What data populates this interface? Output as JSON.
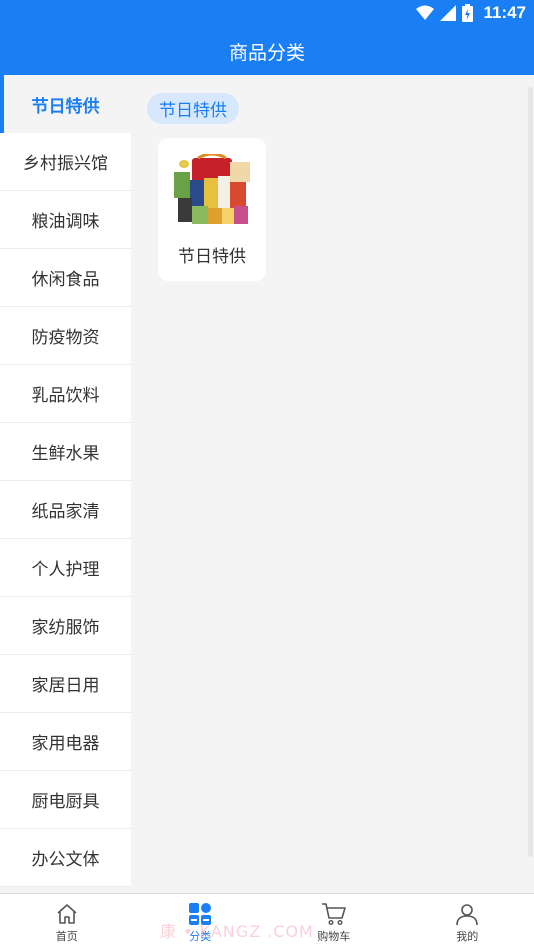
{
  "status_bar": {
    "time": "11:47"
  },
  "header": {
    "title": "商品分类"
  },
  "sidebar": {
    "items": [
      {
        "label": "节日特供",
        "active": true
      },
      {
        "label": "乡村振兴馆"
      },
      {
        "label": "粮油调味"
      },
      {
        "label": "休闲食品"
      },
      {
        "label": "防疫物资"
      },
      {
        "label": "乳品饮料"
      },
      {
        "label": "生鲜水果"
      },
      {
        "label": "纸品家清"
      },
      {
        "label": "个人护理"
      },
      {
        "label": "家纺服饰"
      },
      {
        "label": "家居日用"
      },
      {
        "label": "家用电器"
      },
      {
        "label": "厨电厨具"
      },
      {
        "label": "办公文体"
      }
    ]
  },
  "content": {
    "category_tag": "节日特供",
    "products": [
      {
        "name": "节日特供",
        "image": "gift-box-assortment"
      }
    ]
  },
  "tabbar": {
    "tabs": [
      {
        "label": "首页",
        "icon": "home-icon"
      },
      {
        "label": "分类",
        "icon": "category-icon",
        "active": true
      },
      {
        "label": "购物车",
        "icon": "cart-icon"
      },
      {
        "label": "我的",
        "icon": "user-icon"
      }
    ]
  },
  "watermark": "康 • KANGZ .COM",
  "colors": {
    "primary": "#1a7ef5",
    "tag_bg": "#d7e8fc",
    "page_bg": "#f4f4f4"
  }
}
